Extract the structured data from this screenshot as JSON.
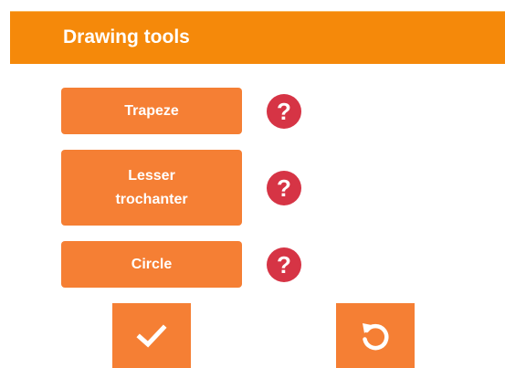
{
  "panel": {
    "title": "Drawing tools",
    "accent_color": "#f5890a",
    "button_color": "#f57f34",
    "help_color": "#d63445"
  },
  "tools": [
    {
      "label": "Trapeze",
      "help_icon": "question-mark-icon",
      "help_glyph": "?"
    },
    {
      "label": "Lesser\ntrochanter",
      "help_icon": "question-mark-icon",
      "help_glyph": "?"
    },
    {
      "label": "Circle",
      "help_icon": "question-mark-icon",
      "help_glyph": "?"
    }
  ],
  "actions": {
    "confirm_icon": "checkmark-icon",
    "reset_icon": "rotate-ccw-icon"
  }
}
